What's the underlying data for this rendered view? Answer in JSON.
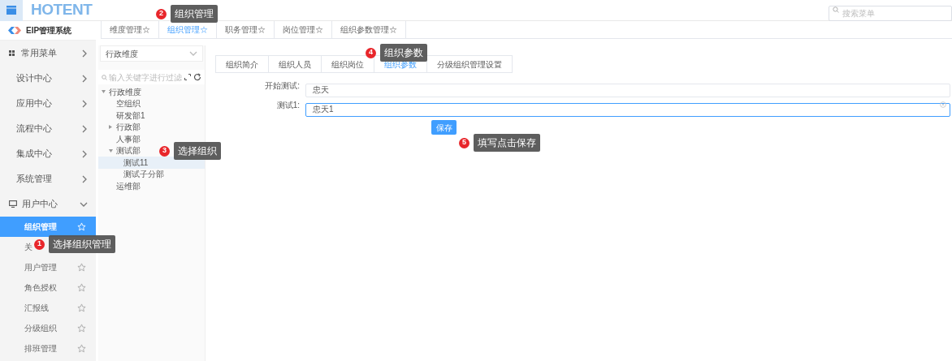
{
  "header": {
    "logo": "HOTENT",
    "search_placeholder": "搜索菜单"
  },
  "sidebar": {
    "system_name": "EIP管理系统",
    "menu": [
      {
        "label": "常用菜单",
        "kind": "favorites",
        "expanded": false
      },
      {
        "label": "设计中心",
        "kind": "link",
        "expanded": false
      },
      {
        "label": "应用中心",
        "kind": "link",
        "expanded": false
      },
      {
        "label": "流程中心",
        "kind": "link",
        "expanded": false
      },
      {
        "label": "集成中心",
        "kind": "link",
        "expanded": false
      },
      {
        "label": "系统管理",
        "kind": "link",
        "expanded": false
      },
      {
        "label": "用户中心",
        "kind": "section",
        "expanded": true,
        "children": [
          {
            "label": "组织管理",
            "kind": "starred",
            "selected": true
          },
          {
            "label": "关",
            "kind": "plain",
            "selected": false
          },
          {
            "label": "用户管理",
            "kind": "starred",
            "selected": false
          },
          {
            "label": "角色授权",
            "kind": "starred",
            "selected": false
          },
          {
            "label": "汇报线",
            "kind": "starred",
            "selected": false
          },
          {
            "label": "分级组织",
            "kind": "starred",
            "selected": false
          },
          {
            "label": "排班管理",
            "kind": "starred",
            "selected": false
          }
        ]
      }
    ]
  },
  "tabs": [
    {
      "label": "维度管理☆",
      "selected": false
    },
    {
      "label": "组织管理☆",
      "selected": true
    },
    {
      "label": "职务管理☆",
      "selected": false
    },
    {
      "label": "岗位管理☆",
      "selected": false
    },
    {
      "label": "组织参数管理☆",
      "selected": false
    }
  ],
  "tree_panel": {
    "dimension": "行政维度",
    "filter_placeholder": "输入关键字进行过滤",
    "nodes": [
      {
        "label": "行政维度",
        "expanded": true,
        "selected": false,
        "children": [
          {
            "label": "空组织",
            "selected": false
          },
          {
            "label": "研发部1",
            "selected": false
          },
          {
            "label": "行政部",
            "expanded": false,
            "selected": false
          },
          {
            "label": "人事部",
            "selected": false
          },
          {
            "label": "测试部",
            "expanded": true,
            "selected": false,
            "children": [
              {
                "label": "测试11",
                "selected": true
              },
              {
                "label": "测试子分部",
                "selected": false
              }
            ]
          },
          {
            "label": "运维部",
            "selected": false
          }
        ]
      }
    ]
  },
  "content": {
    "subtabs": [
      {
        "label": "组织简介",
        "selected": false
      },
      {
        "label": "组织人员",
        "selected": false
      },
      {
        "label": "组织岗位",
        "selected": false
      },
      {
        "label": "组织参数",
        "selected": true
      },
      {
        "label": "分级组织管理设置",
        "selected": false
      }
    ],
    "fields": [
      {
        "label": "开始测试:",
        "value": "忠天",
        "focused": false
      },
      {
        "label": "测试1:",
        "value": "忠天1",
        "focused": true
      }
    ],
    "save_button": "保存"
  },
  "callouts": [
    {
      "number": "1",
      "text": "选择组织管理"
    },
    {
      "number": "2",
      "text": "组织管理"
    },
    {
      "number": "3",
      "text": "选择组织"
    },
    {
      "number": "4",
      "text": "组织参数"
    },
    {
      "number": "5",
      "text": "填写点击保存"
    }
  ]
}
